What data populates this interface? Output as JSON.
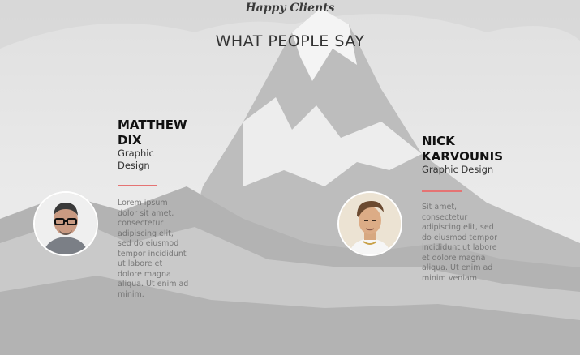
{
  "section": {
    "subtitle": "Happy Clients",
    "title": "WHAT PEOPLE SAY"
  },
  "testimonials": [
    {
      "name": "MATTHEW DIX",
      "role": "Graphic Design",
      "quote": "Lorem ipsum dolor sit amet, consectetur adipiscing elit, sed do eiusmod tempor incididunt ut labore et dolore magna aliqua. Ut enim ad minim.",
      "avatar": "man-with-glasses-portrait"
    },
    {
      "name": "NICK KARVOUNIS",
      "role": "Graphic Design",
      "quote": "Sit amet, consectetur adipiscing elit, sed do eiusmod tempor incididunt ut labore et dolore magna aliqua. Ut enim ad minim veniam",
      "avatar": "young-man-portrait"
    }
  ],
  "colors": {
    "accent": "#e57373"
  },
  "background": "snowy-mountain-photo"
}
